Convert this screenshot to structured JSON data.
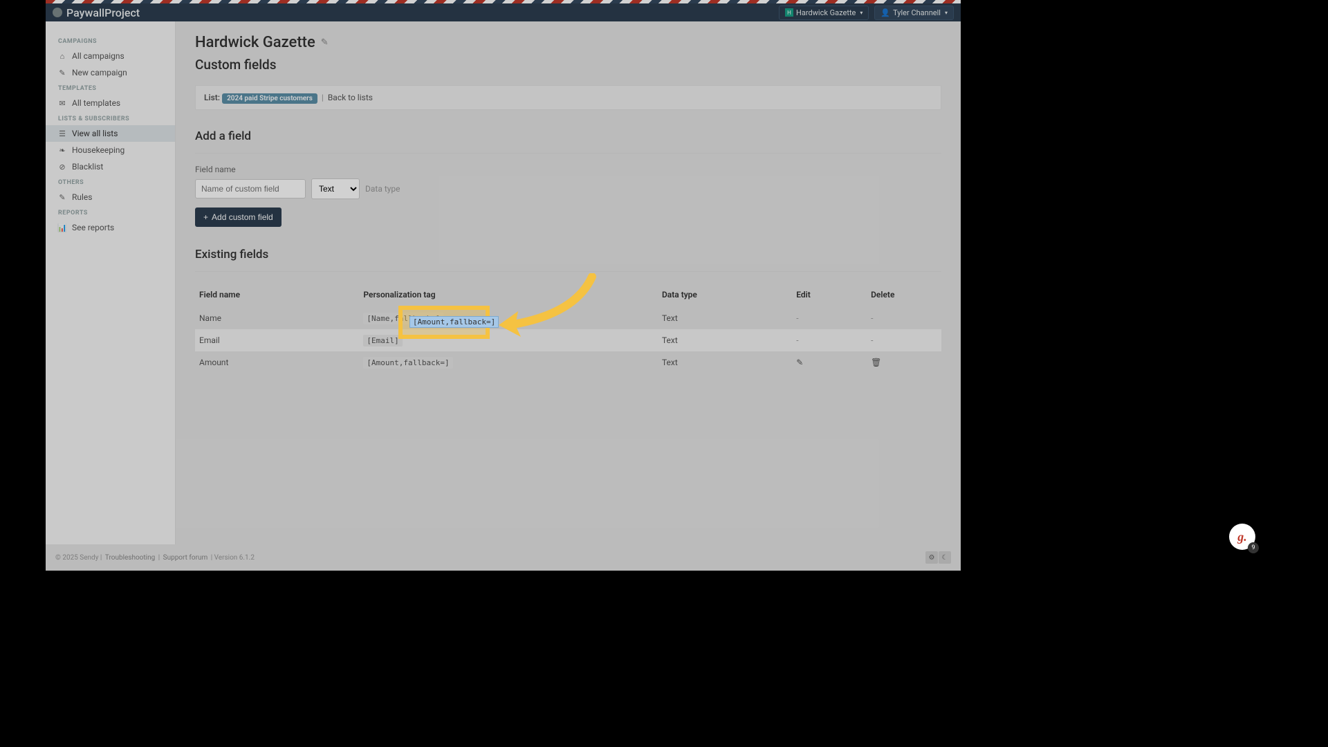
{
  "brand": "PaywallProject",
  "top": {
    "gazette": "Hardwick Gazette",
    "user": "Tyler Channell"
  },
  "sidebar": {
    "sections": {
      "campaigns": "CAMPAIGNS",
      "templates": "TEMPLATES",
      "lists": "LISTS & SUBSCRIBERS",
      "others": "OTHERS",
      "reports": "REPORTS"
    },
    "items": {
      "all_campaigns": "All campaigns",
      "new_campaign": "New campaign",
      "all_templates": "All templates",
      "view_all_lists": "View all lists",
      "housekeeping": "Housekeeping",
      "blacklist": "Blacklist",
      "rules": "Rules",
      "see_reports": "See reports"
    }
  },
  "page": {
    "title": "Hardwick Gazette",
    "subtitle": "Custom fields",
    "list_label": "List:",
    "list_badge": "2024 paid Stripe customers",
    "back": "Back to lists",
    "add_head": "Add a field",
    "field_name_label": "Field name",
    "field_name_placeholder": "Name of custom field",
    "type_select": "Text",
    "type_hint": "Data type",
    "add_btn": "Add custom field",
    "existing_head": "Existing fields"
  },
  "table": {
    "headers": {
      "name": "Field name",
      "tag": "Personalization tag",
      "type": "Data type",
      "edit": "Edit",
      "delete": "Delete"
    },
    "rows": [
      {
        "name": "Name",
        "tag": "[Name,fallback=]",
        "type": "Text",
        "edit": "-",
        "delete": "-"
      },
      {
        "name": "Email",
        "tag": "[Email]",
        "type": "Text",
        "edit": "-",
        "delete": "-"
      },
      {
        "name": "Amount",
        "tag": "[Amount,fallback=]",
        "type": "Text",
        "edit": "icon",
        "delete": "icon"
      }
    ]
  },
  "highlight_tag": "[Amount,fallback=]",
  "footer": {
    "copyright": "© 2025 Sendy",
    "troubleshoot": "Troubleshooting",
    "support": "Support forum",
    "version": "Version 6.1.2"
  },
  "fab": {
    "letter": "g.",
    "count": "9"
  }
}
